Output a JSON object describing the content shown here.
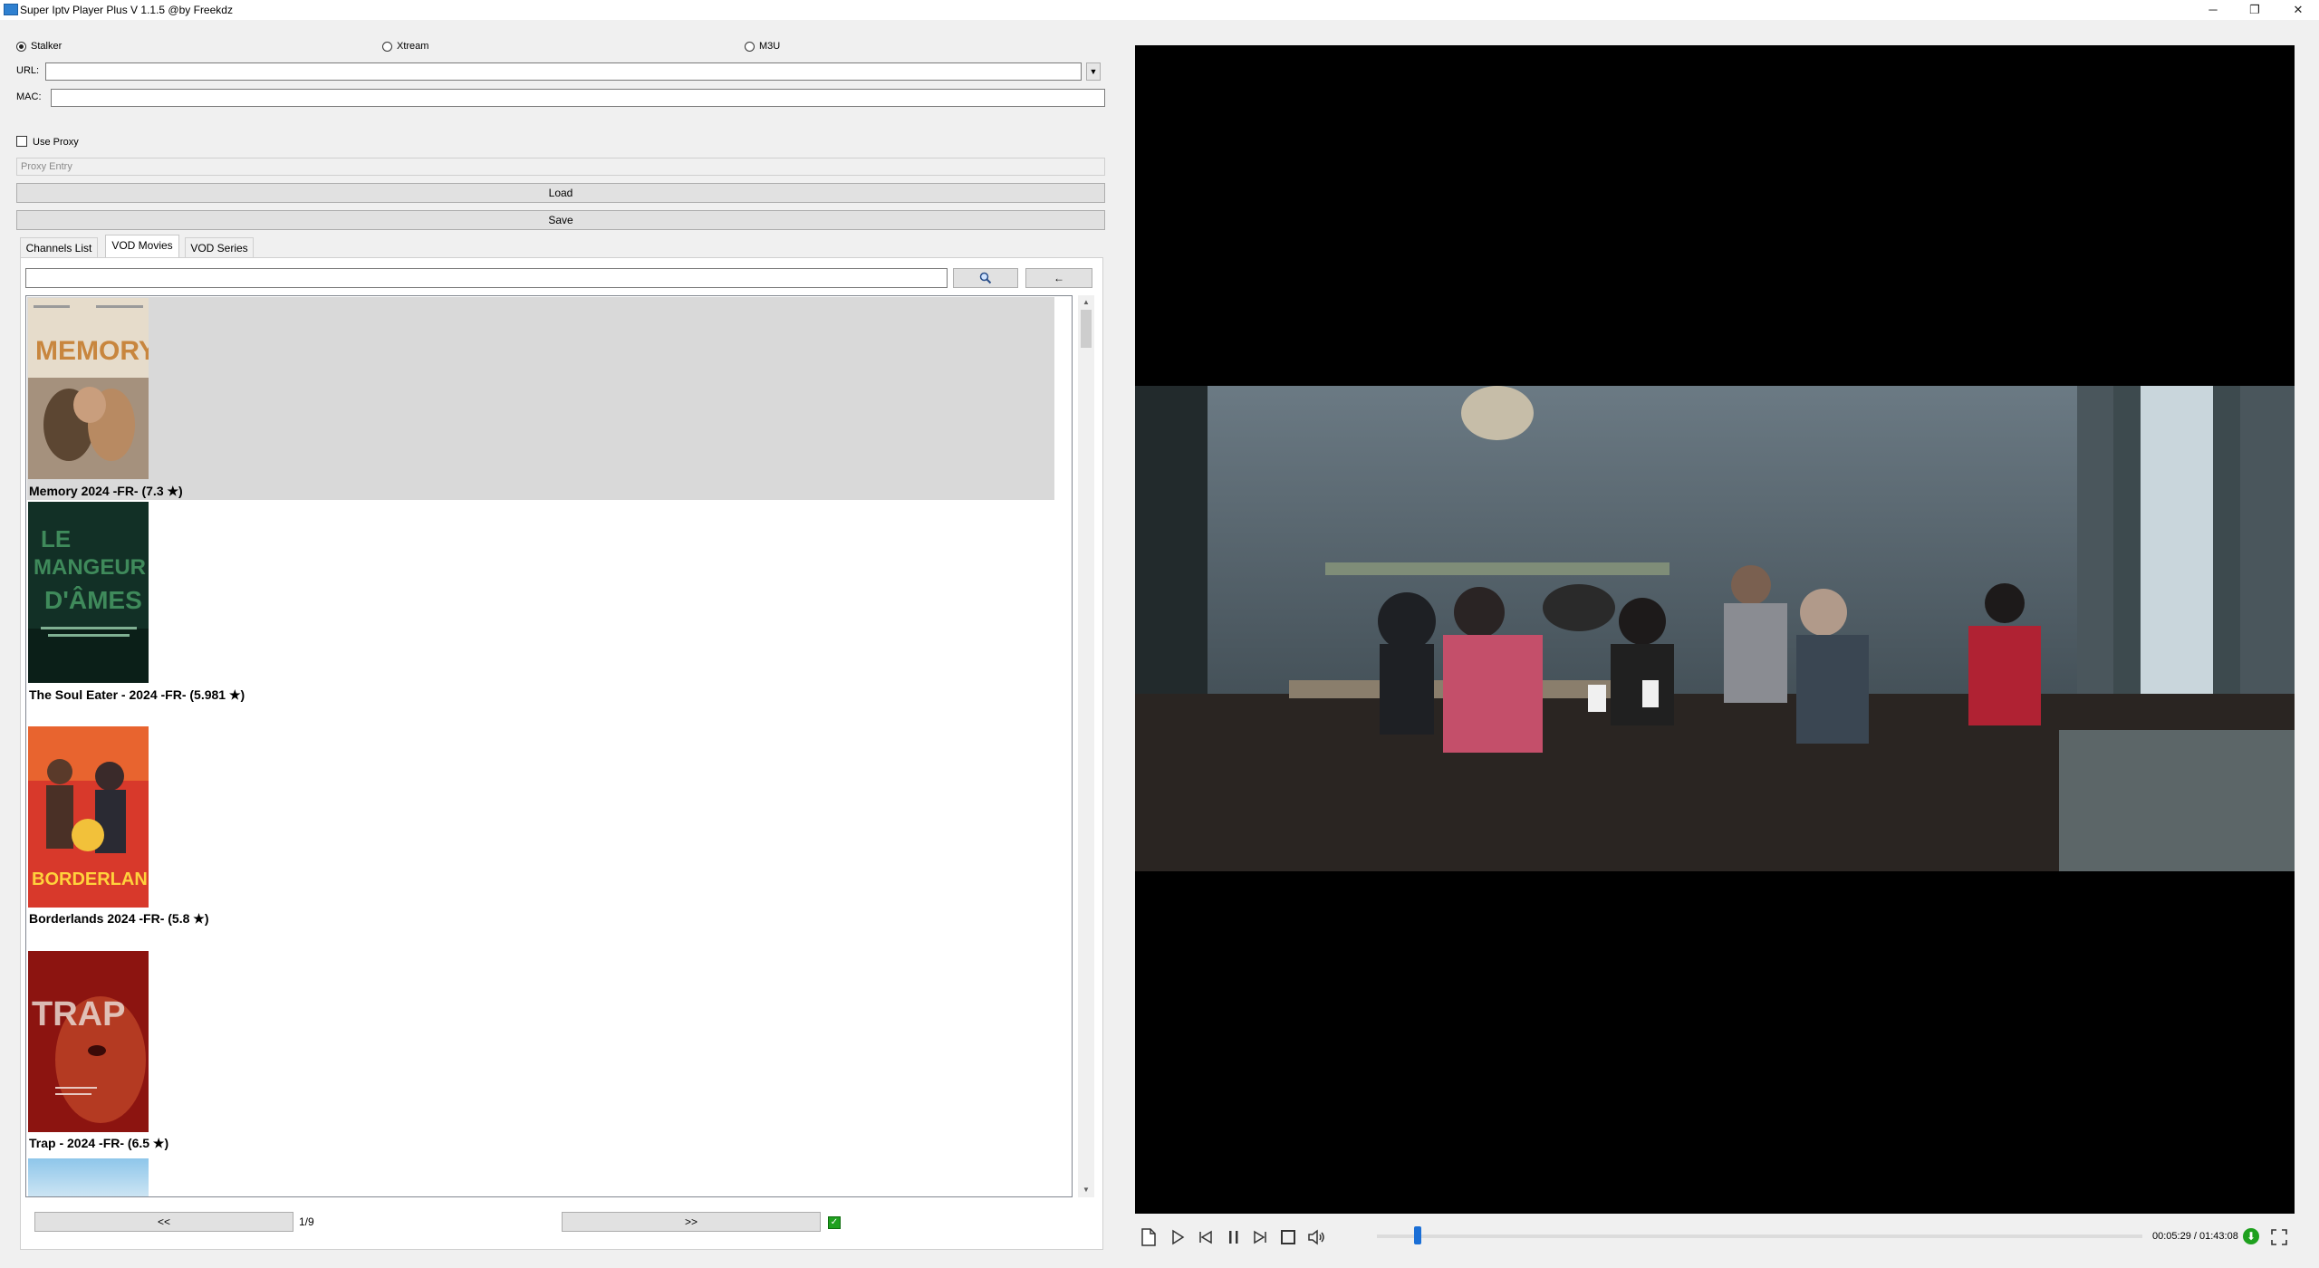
{
  "window": {
    "title": "Super Iptv Player Plus V 1.1.5 @by Freekdz",
    "minimize": "─",
    "restore": "❐",
    "close": "✕"
  },
  "source_type": {
    "options": [
      "Stalker",
      "Xtream",
      "M3U"
    ],
    "selected": "Stalker"
  },
  "form": {
    "url_label": "URL:",
    "url_value": "",
    "mac_label": "MAC:",
    "mac_value": "",
    "use_proxy_label": "Use Proxy",
    "use_proxy_checked": false,
    "proxy_placeholder": "Proxy Entry",
    "load_label": "Load",
    "save_label": "Save"
  },
  "tabs": [
    {
      "label": "Channels List",
      "active": false
    },
    {
      "label": "VOD Movies",
      "active": true
    },
    {
      "label": "VOD Series",
      "active": false
    }
  ],
  "search": {
    "value": "",
    "search_icon": "magnifier-icon",
    "back_label": "←"
  },
  "movies": [
    {
      "title": "Memory 2024 -FR- (7.3 ★)",
      "poster_text": "MEMORY",
      "selected": true
    },
    {
      "title": "The Soul Eater - 2024 -FR- (5.981 ★)",
      "poster_text": "LE MANGEUR D'ÂMES",
      "selected": false
    },
    {
      "title": "Borderlands 2024 -FR- (5.8 ★)",
      "poster_text": "BORDERLANDS",
      "selected": false
    },
    {
      "title": "Trap - 2024 -FR- (6.5 ★)",
      "poster_text": "TRAP",
      "selected": false
    }
  ],
  "pager": {
    "prev_label": "<<",
    "next_label": ">>",
    "page": "1/9",
    "status_icon": "green-check-icon"
  },
  "player": {
    "time": "00:05:29 / 01:43:08",
    "progress": 0.053,
    "controls": [
      "open-file-icon",
      "play-icon",
      "previous-icon",
      "pause-icon",
      "next-icon",
      "stop-icon",
      "volume-icon",
      "download-icon",
      "fullscreen-icon"
    ]
  }
}
